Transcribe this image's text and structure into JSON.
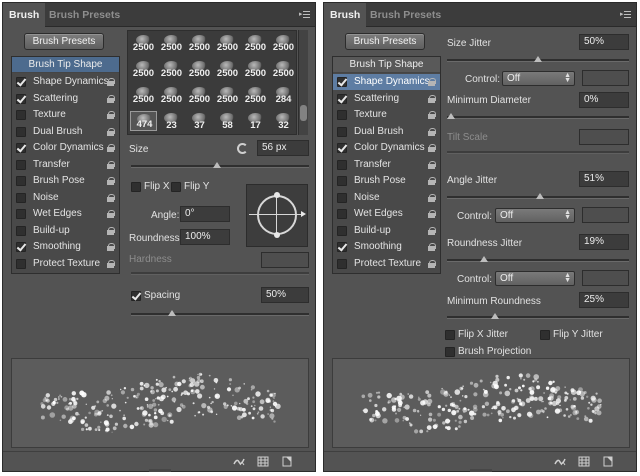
{
  "panels": [
    {
      "tabs": {
        "brush": "Brush",
        "presets": "Brush Presets"
      },
      "presets_button": "Brush Presets",
      "options": [
        {
          "label": "Brush Tip Shape",
          "checked": null,
          "selected": true
        },
        {
          "label": "Shape Dynamics",
          "checked": true
        },
        {
          "label": "Scattering",
          "checked": true
        },
        {
          "label": "Texture",
          "checked": false
        },
        {
          "label": "Dual Brush",
          "checked": false
        },
        {
          "label": "Color Dynamics",
          "checked": true
        },
        {
          "label": "Transfer",
          "checked": false
        },
        {
          "label": "Brush Pose",
          "checked": false
        },
        {
          "label": "Noise",
          "checked": false
        },
        {
          "label": "Wet Edges",
          "checked": false
        },
        {
          "label": "Build-up",
          "checked": false
        },
        {
          "label": "Smoothing",
          "checked": true
        },
        {
          "label": "Protect Texture",
          "checked": false
        }
      ],
      "brush_grid": [
        [
          "2500",
          "2500",
          "2500",
          "2500",
          "2500",
          "2500"
        ],
        [
          "2500",
          "2500",
          "2500",
          "2500",
          "2500",
          "2500"
        ],
        [
          "2500",
          "2500",
          "2500",
          "2500",
          "2500",
          "284"
        ],
        [
          "474",
          "23",
          "37",
          "58",
          "17",
          "32"
        ]
      ],
      "size": {
        "label": "Size",
        "value": "56 px",
        "level": 0.48
      },
      "flip_x": "Flip X",
      "flip_y": "Flip Y",
      "angle": {
        "label": "Angle:",
        "value": "0°"
      },
      "roundness": {
        "label": "Roundness:",
        "value": "100%"
      },
      "hardness": {
        "label": "Hardness"
      },
      "spacing": {
        "label": "Spacing",
        "value": "50%",
        "checked": true,
        "level": 0.22
      }
    },
    {
      "tabs": {
        "brush": "Brush",
        "presets": "Brush Presets"
      },
      "presets_button": "Brush Presets",
      "options": [
        {
          "label": "Brush Tip Shape",
          "checked": null
        },
        {
          "label": "Shape Dynamics",
          "checked": true,
          "selected": true
        },
        {
          "label": "Scattering",
          "checked": true
        },
        {
          "label": "Texture",
          "checked": false
        },
        {
          "label": "Dual Brush",
          "checked": false
        },
        {
          "label": "Color Dynamics",
          "checked": true
        },
        {
          "label": "Transfer",
          "checked": false
        },
        {
          "label": "Brush Pose",
          "checked": false
        },
        {
          "label": "Noise",
          "checked": false
        },
        {
          "label": "Wet Edges",
          "checked": false
        },
        {
          "label": "Build-up",
          "checked": false
        },
        {
          "label": "Smoothing",
          "checked": true
        },
        {
          "label": "Protect Texture",
          "checked": false
        }
      ],
      "size_jitter": {
        "label": "Size Jitter",
        "value": "50%",
        "level": 0.5
      },
      "control1": {
        "label": "Control:",
        "value": "Off"
      },
      "min_diameter": {
        "label": "Minimum Diameter",
        "value": "0%",
        "level": 0
      },
      "tilt_scale": {
        "label": "Tilt Scale"
      },
      "angle_jitter": {
        "label": "Angle Jitter",
        "value": "51%",
        "level": 0.51
      },
      "control2": {
        "label": "Control:",
        "value": "Off"
      },
      "roundness_jitter": {
        "label": "Roundness Jitter",
        "value": "19%",
        "level": 0.19
      },
      "control3": {
        "label": "Control:",
        "value": "Off"
      },
      "min_roundness": {
        "label": "Minimum Roundness",
        "value": "25%",
        "level": 0.25
      },
      "flip_x_jitter": "Flip X Jitter",
      "flip_y_jitter": "Flip Y Jitter",
      "brush_projection": "Brush Projection"
    }
  ]
}
